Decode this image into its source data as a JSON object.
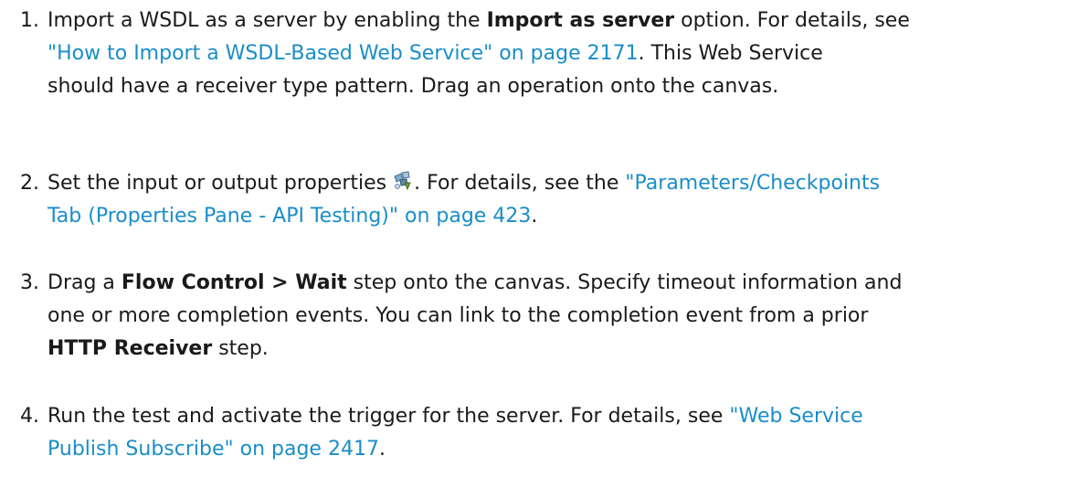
{
  "steps": [
    {
      "number": "1.",
      "t1": "Import a WSDL as a server by enabling the ",
      "b1": "Import as server",
      "t2": " option. For details, see",
      "link1": "\"How to Import a WSDL-Based Web Service\" on page 2171",
      "t3": ". This Web Service",
      "t4": "should have a receiver type pattern. Drag an operation onto the canvas."
    },
    {
      "number": "2.",
      "t1": "Set the input or output properties",
      "icon": "properties-icon",
      "t2": ". For details, see the ",
      "link1": "\"Parameters/Checkpoints",
      "link2": "Tab (Properties Pane - API Testing)\" on page 423",
      "t3": "."
    },
    {
      "number": "3.",
      "t1": "Drag a ",
      "b1": "Flow Control > Wait",
      "t2": " step onto the canvas. Specify timeout information and",
      "t3": "one or more completion events. You can link to the completion event from a prior",
      "b2": "HTTP Receiver",
      "t4": " step."
    },
    {
      "number": "4.",
      "t1": "Run the test and activate the trigger for the server. For details, see ",
      "link1": "\"Web Service",
      "link2": "Publish Subscribe\" on page 2417",
      "t2": "."
    }
  ],
  "colors": {
    "link": "#1a8dc8",
    "text": "#1a1a1a"
  }
}
